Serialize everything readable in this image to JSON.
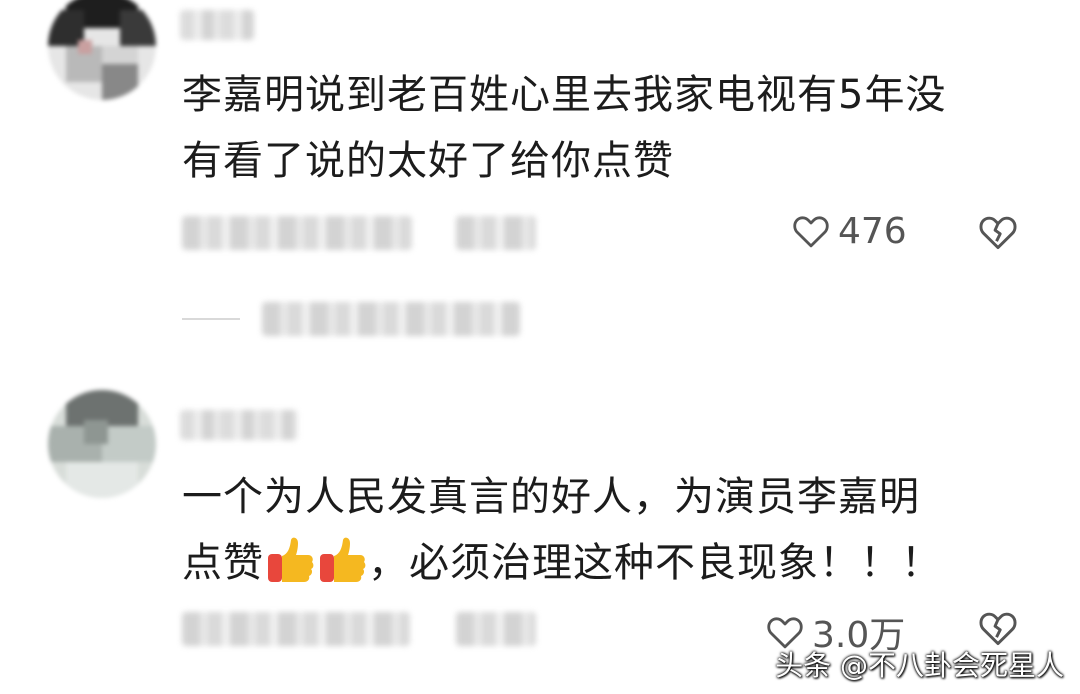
{
  "comments": [
    {
      "text_line1": "李嘉明说到老百姓心里去我家电视有5年没",
      "text_line2": "有看了说的太好了给你点赞",
      "likes": "476"
    },
    {
      "text_part1": "一个为人民发真言的好人，为演员李嘉明",
      "text_part2_prefix": "点赞",
      "text_part2_suffix": "，必须治理这种不良现象！！！",
      "likes": "3.0万"
    }
  ],
  "watermark": "头条 @不八卦会死星人",
  "icons": {
    "like": "heart-outline-icon",
    "dislike": "broken-heart-icon",
    "emoji": "thumbs-up-emoji"
  },
  "colors": {
    "text": "#1c1c1c",
    "meta": "#555555",
    "thumb": "#f5b820",
    "cuff": "#e8473c"
  }
}
